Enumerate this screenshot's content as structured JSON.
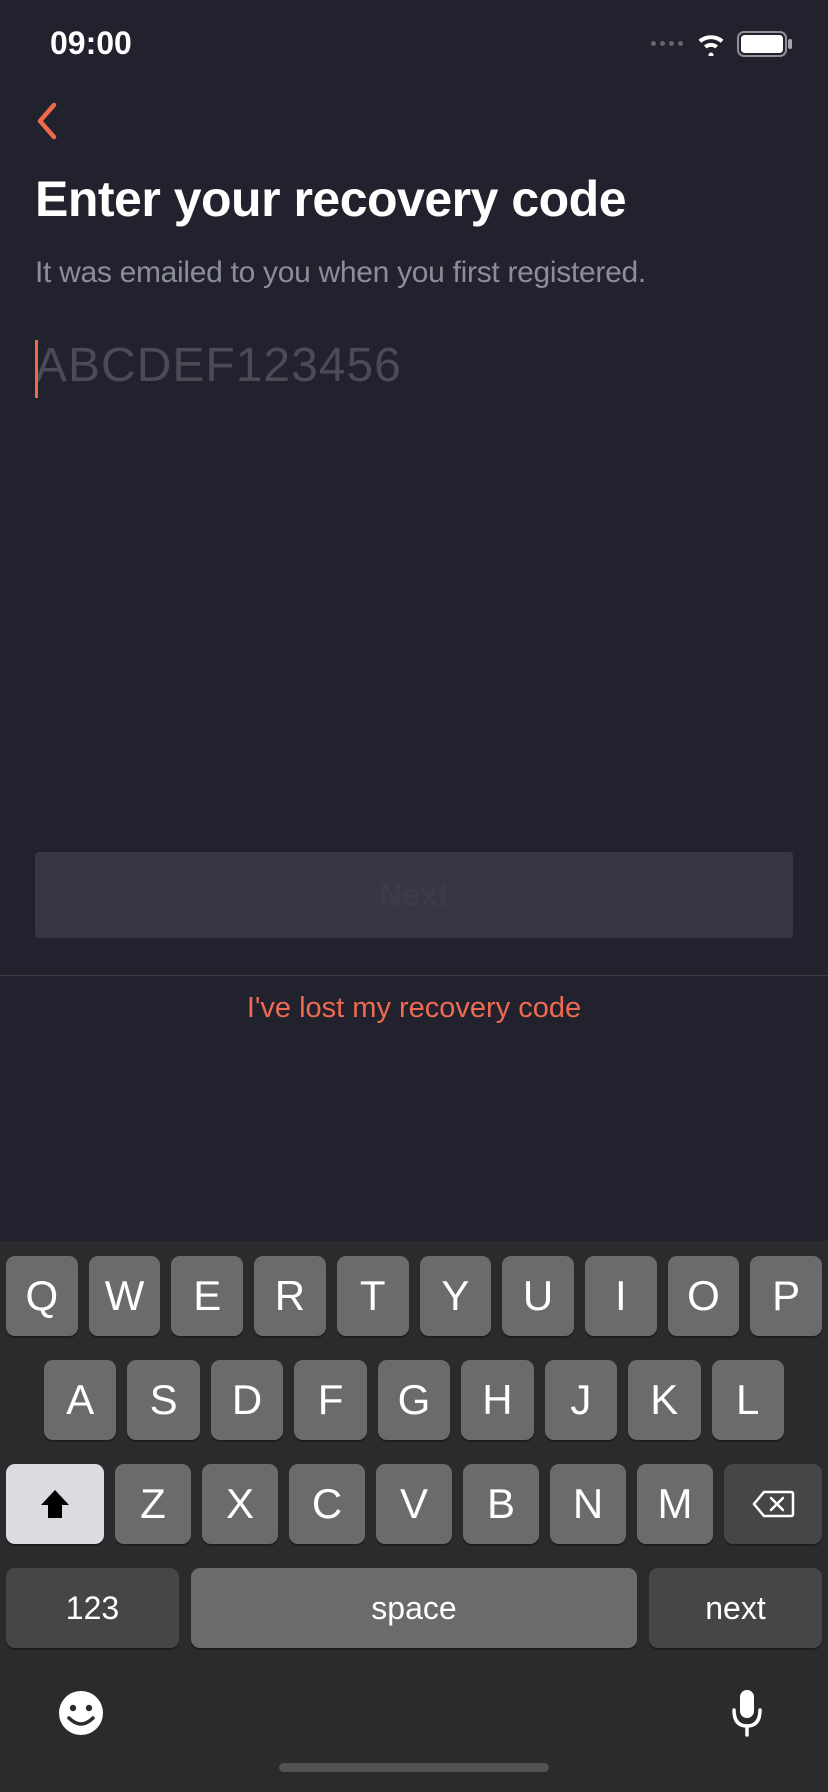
{
  "status": {
    "time": "09:00"
  },
  "screen": {
    "title": "Enter your recovery code",
    "subtitle": "It was emailed to you when you first registered.",
    "input_value": "",
    "input_placeholder": "ABCDEF123456",
    "next_button": "Next",
    "lost_link": "I've lost my recovery code"
  },
  "keyboard": {
    "row1": [
      "Q",
      "W",
      "E",
      "R",
      "T",
      "Y",
      "U",
      "I",
      "O",
      "P"
    ],
    "row2": [
      "A",
      "S",
      "D",
      "F",
      "G",
      "H",
      "J",
      "K",
      "L"
    ],
    "row3": [
      "Z",
      "X",
      "C",
      "V",
      "B",
      "N",
      "M"
    ],
    "num_key": "123",
    "space_key": "space",
    "next_key": "next"
  },
  "colors": {
    "background": "#21222e",
    "accent": "#f0694b",
    "muted_text": "#8c8d98",
    "placeholder": "#4a4b56"
  }
}
